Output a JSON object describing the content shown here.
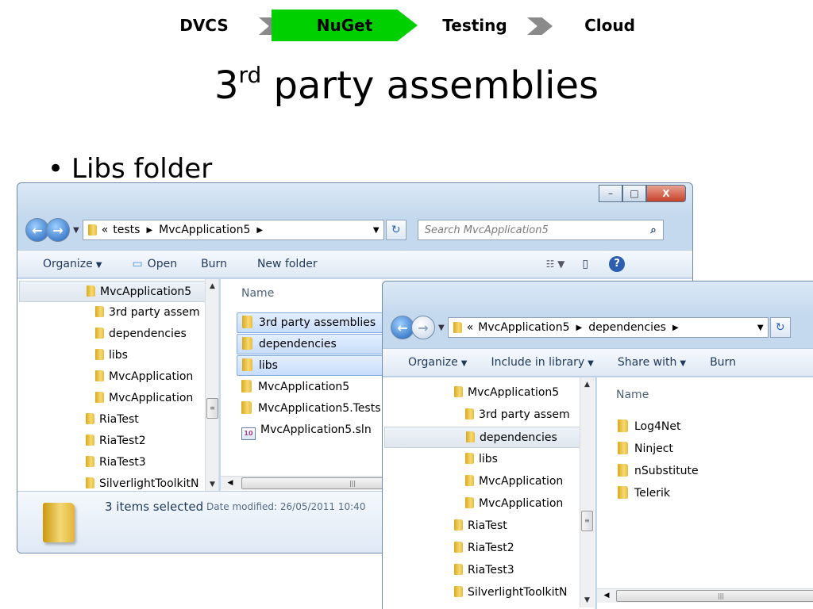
{
  "header": {
    "steps": [
      "DVCS",
      "NuGet",
      "Testing",
      "Cloud"
    ],
    "active_step": "NuGet",
    "active_color": "#00d000",
    "title_main": "3",
    "title_sup": "rd",
    "title_rest": " party assemblies",
    "bullet": "Libs folder"
  },
  "window1": {
    "caption_buttons": {
      "minimize": "–",
      "maximize": "□",
      "close": "X"
    },
    "breadcrumb": [
      "«",
      "tests",
      "MvcApplication5"
    ],
    "search_placeholder": "Search MvcApplication5",
    "toolbar": {
      "organize": "Organize",
      "open": "Open",
      "burn": "Burn",
      "new_folder": "New folder"
    },
    "nav_tree": [
      "MvcApplication5",
      "3rd party assem",
      "dependencies",
      "libs",
      "MvcApplication",
      "MvcApplication",
      "RiaTest",
      "RiaTest2",
      "RiaTest3",
      "SilverlightToolkitN"
    ],
    "column_header": "Name",
    "files": [
      "3rd party assemblies",
      "dependencies",
      "libs",
      "MvcApplication5",
      "MvcApplication5.Tests",
      "MvcApplication5.sln"
    ],
    "selected_count": "3 items selected",
    "date_modified": "Date modified: 26/05/2011 10:40"
  },
  "window2": {
    "breadcrumb": [
      "«",
      "MvcApplication5",
      "dependencies"
    ],
    "toolbar": {
      "organize": "Organize",
      "include": "Include in library",
      "share": "Share with",
      "burn": "Burn"
    },
    "nav_tree": [
      "MvcApplication5",
      "3rd party assem",
      "dependencies",
      "libs",
      "MvcApplication",
      "MvcApplication",
      "RiaTest",
      "RiaTest2",
      "RiaTest3",
      "SilverlightToolkitN"
    ],
    "column_header": "Name",
    "files": [
      "Log4Net",
      "Ninject",
      "nSubstitute",
      "Telerik"
    ]
  }
}
